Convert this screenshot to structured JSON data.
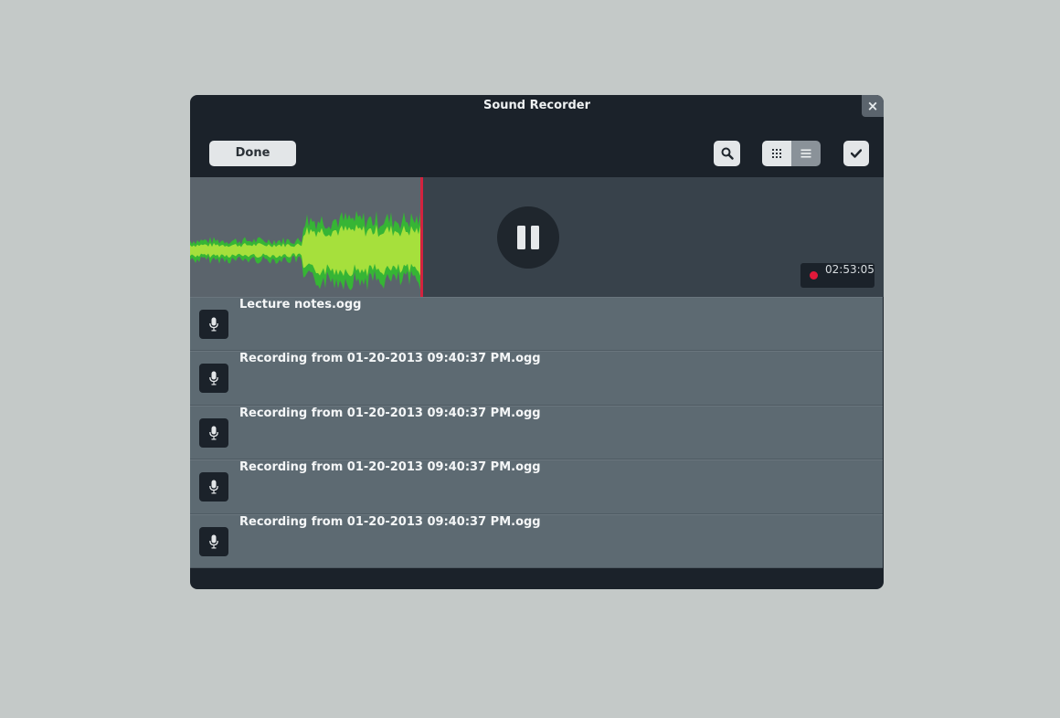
{
  "window": {
    "title": "Sound Recorder",
    "close_label": "×"
  },
  "toolbar": {
    "done_label": "Done",
    "search_icon": "search-icon",
    "grid_icon": "grid-view-icon",
    "list_icon": "list-view-icon",
    "select_icon": "checkmark-icon"
  },
  "recorder": {
    "state": "recording",
    "elapsed": "02:53:05",
    "pause_icon": "pause-icon",
    "record_color": "#e0193a",
    "wave_colors": {
      "outer": "#36b535",
      "inner": "#a6e03c"
    }
  },
  "recordings": [
    {
      "name": "Lecture notes.ogg",
      "icon": "microphone-icon"
    },
    {
      "name": "Recording from 01-20-2013 09:40:37 PM.ogg",
      "icon": "microphone-icon"
    },
    {
      "name": "Recording from 01-20-2013 09:40:37 PM.ogg",
      "icon": "microphone-icon"
    },
    {
      "name": "Recording from 01-20-2013 09:40:37 PM.ogg",
      "icon": "microphone-icon"
    },
    {
      "name": "Recording from 01-20-2013 09:40:37 PM.ogg",
      "icon": "microphone-icon"
    }
  ]
}
